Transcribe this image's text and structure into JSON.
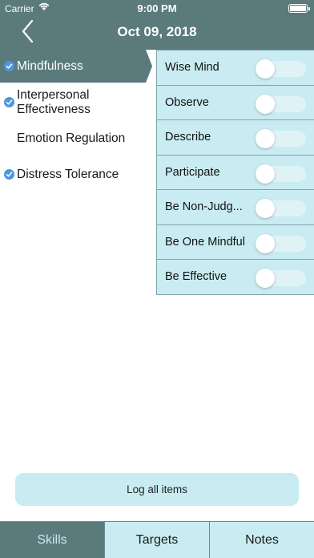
{
  "status_bar": {
    "carrier": "Carrier",
    "time": "9:00 PM"
  },
  "nav": {
    "title": "Oct 09, 2018",
    "back_icon": "chevron-left-icon"
  },
  "categories": [
    {
      "label": "Mindfulness",
      "checked": true,
      "selected": true
    },
    {
      "label": "Interpersonal Effectiveness",
      "checked": true,
      "selected": false
    },
    {
      "label": "Emotion Regulation",
      "checked": false,
      "selected": false
    },
    {
      "label": "Distress Tolerance",
      "checked": true,
      "selected": false
    }
  ],
  "skills": [
    {
      "label": "Wise Mind",
      "on": false
    },
    {
      "label": "Observe",
      "on": false
    },
    {
      "label": "Describe",
      "on": false
    },
    {
      "label": "Participate",
      "on": false
    },
    {
      "label": "Be Non-Judg...",
      "on": false
    },
    {
      "label": "Be One Mindful",
      "on": false
    },
    {
      "label": "Be Effective",
      "on": false
    }
  ],
  "log_button": {
    "label": "Log all items"
  },
  "tabs": [
    {
      "label": "Skills",
      "active": true
    },
    {
      "label": "Targets",
      "active": false
    },
    {
      "label": "Notes",
      "active": false
    }
  ],
  "colors": {
    "header": "#5a7a7c",
    "panel": "#c9ecf2",
    "check": "#4e97e0"
  }
}
